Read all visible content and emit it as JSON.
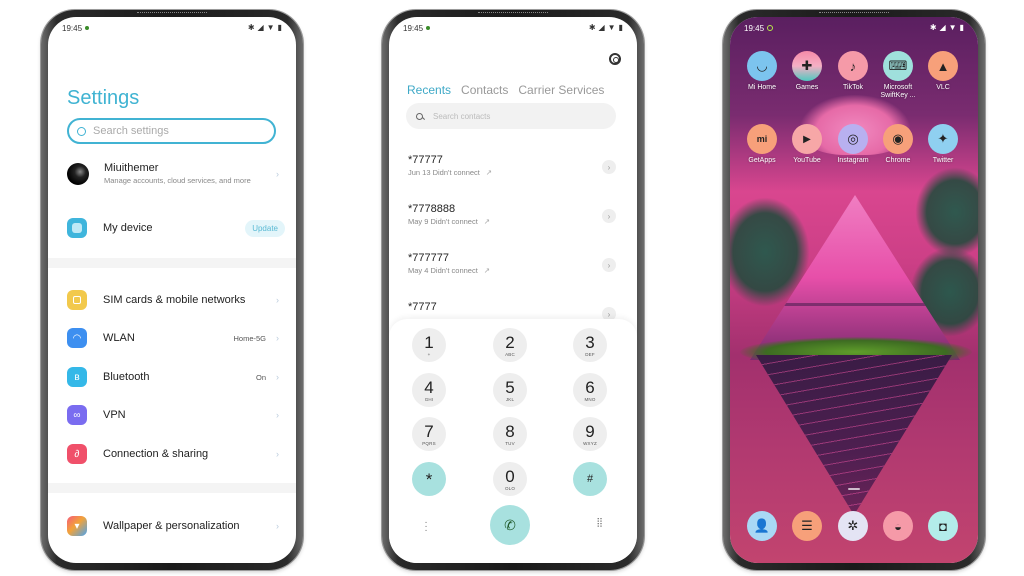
{
  "status": {
    "time": "19:45"
  },
  "settings": {
    "title": "Settings",
    "search_placeholder": "Search settings",
    "account": {
      "name": "Miuithemer",
      "subtitle": "Manage accounts, cloud services, and more"
    },
    "my_device": {
      "label": "My device",
      "badge": "Update"
    },
    "network_items": [
      {
        "label": "SIM cards & mobile networks",
        "value": "",
        "icon": "sim-icon",
        "color": "#f2c94c"
      },
      {
        "label": "WLAN",
        "value": "Home-5G",
        "icon": "wifi-icon",
        "color": "#3d8ff0"
      },
      {
        "label": "Bluetooth",
        "value": "On",
        "icon": "bluetooth-icon",
        "color": "#34b8e8"
      },
      {
        "label": "VPN",
        "value": "",
        "icon": "vpn-icon",
        "color": "#7a6cf0"
      },
      {
        "label": "Connection & sharing",
        "value": "",
        "icon": "connection-icon",
        "color": "#f0506a"
      }
    ],
    "personal_items": [
      {
        "label": "Wallpaper & personalization",
        "icon": "wallpaper-icon"
      }
    ]
  },
  "dialer": {
    "tabs": [
      {
        "label": "Recents",
        "active": true
      },
      {
        "label": "Contacts",
        "active": false
      },
      {
        "label": "Carrier Services",
        "active": false
      }
    ],
    "search_placeholder": "Search contacts",
    "recents": [
      {
        "number": "*77777",
        "meta": "Jun 13 Didn't connect"
      },
      {
        "number": "*7778888",
        "meta": "May 9 Didn't connect"
      },
      {
        "number": "*777777",
        "meta": "May 4 Didn't connect"
      },
      {
        "number": "*7777",
        "meta": ""
      }
    ],
    "keys": [
      {
        "digit": "1",
        "letters": "+"
      },
      {
        "digit": "2",
        "letters": "ABC"
      },
      {
        "digit": "3",
        "letters": "DEF"
      },
      {
        "digit": "4",
        "letters": "GHI"
      },
      {
        "digit": "5",
        "letters": "JKL"
      },
      {
        "digit": "6",
        "letters": "MNO"
      },
      {
        "digit": "7",
        "letters": "PQRS"
      },
      {
        "digit": "8",
        "letters": "TUV"
      },
      {
        "digit": "9",
        "letters": "WXYZ"
      },
      {
        "digit": "*",
        "letters": ""
      },
      {
        "digit": "0",
        "letters": "OLO"
      },
      {
        "digit": "#",
        "letters": ""
      }
    ]
  },
  "home": {
    "apps": [
      {
        "name": "Mi Home",
        "icon": "mi-home-icon",
        "glyph": "◡",
        "color": "#7cc4ee"
      },
      {
        "name": "Games",
        "icon": "games-icon",
        "glyph": "✚",
        "color": "#f5b0c5"
      },
      {
        "name": "TikTok",
        "icon": "tiktok-icon",
        "glyph": "♪",
        "color": "#f59aa8"
      },
      {
        "name": "Microsoft SwiftKey ...",
        "icon": "swiftkey-icon",
        "glyph": "⌨",
        "color": "#9fe0dc"
      },
      {
        "name": "VLC",
        "icon": "vlc-icon",
        "glyph": "▲",
        "color": "#f7a07a"
      },
      {
        "name": "GetApps",
        "icon": "getapps-icon",
        "glyph": "mi",
        "color": "#f7a07a"
      },
      {
        "name": "YouTube",
        "icon": "youtube-icon",
        "glyph": "▶",
        "color": "#f7a7a7"
      },
      {
        "name": "Instagram",
        "icon": "instagram-icon",
        "glyph": "◎",
        "color": "#b8b0f0"
      },
      {
        "name": "Chrome",
        "icon": "chrome-icon",
        "glyph": "◉",
        "color": "#f7a07a"
      },
      {
        "name": "Twitter",
        "icon": "twitter-icon",
        "glyph": "✦",
        "color": "#8fd0f0"
      }
    ],
    "dock": [
      {
        "icon": "contacts-icon",
        "glyph": "👤",
        "color": "#a9d8f5"
      },
      {
        "icon": "messages-icon",
        "glyph": "☰",
        "color": "#f7a07a"
      },
      {
        "icon": "settings-icon",
        "glyph": "✲",
        "color": "#e4e4f4"
      },
      {
        "icon": "gallery-icon",
        "glyph": "◒",
        "color": "#f59aa8"
      },
      {
        "icon": "camera-icon",
        "glyph": "◘",
        "color": "#b3ecea"
      }
    ]
  }
}
